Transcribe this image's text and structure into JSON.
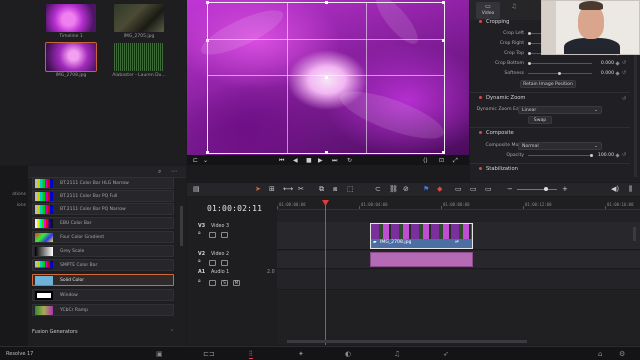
{
  "media_pool": {
    "clips": [
      {
        "name": "Timeline 1",
        "thumb": "flower"
      },
      {
        "name": "IMG_2705.jpg",
        "thumb": "dark"
      },
      {
        "name": "IMG_2708.jpg",
        "thumb": "flower2",
        "selected": true
      },
      {
        "name": "Alabaster - Lauren Du...",
        "thumb": "wave"
      }
    ]
  },
  "viewer": {
    "controls": [
      "⊏",
      "⌄",
      "⏮",
      "◀",
      "■",
      "▶",
      "⏭",
      "↻",
      "⟨⟩",
      "⊡",
      "⤢"
    ]
  },
  "inspector": {
    "tabs": [
      {
        "label": "Video",
        "icon": "video-icon",
        "active": true
      },
      {
        "label": "",
        "icon": "audio-icon",
        "active": false
      }
    ],
    "cropping": {
      "title": "Cropping",
      "params": [
        {
          "label": "Crop Left",
          "value": "",
          "knob": 0.0
        },
        {
          "label": "Crop Right",
          "value": "",
          "knob": 0.0
        },
        {
          "label": "Crop Top",
          "value": "0.000",
          "knob": 0.0
        },
        {
          "label": "Crop Bottom",
          "value": "0.000",
          "knob": 0.0
        },
        {
          "label": "Softness",
          "value": "0.000",
          "knob": 0.5
        }
      ],
      "retain_button": "Retain Image Position"
    },
    "dynamic_zoom": {
      "title": "Dynamic Zoom",
      "ease_label": "Dynamic Zoom Ease",
      "ease_value": "Linear",
      "swap_button": "Swap"
    },
    "composite": {
      "title": "Composite",
      "mode_label": "Composite Mode",
      "mode_value": "Normal",
      "opacity_label": "Opacity",
      "opacity_value": "100.00"
    },
    "stabilization": {
      "title": "Stabilization"
    }
  },
  "effects": {
    "side_labels": [
      "ations",
      "ions"
    ],
    "generators": [
      {
        "label": "BT.2111 Color Bar HLG Narrow",
        "swatch": "bars"
      },
      {
        "label": "BT.2111 Color Bar PQ Full",
        "swatch": "bars"
      },
      {
        "label": "BT.2111 Color Bar PQ Narrow",
        "swatch": "bars"
      },
      {
        "label": "EBU Color Bar",
        "swatch": "ebu"
      },
      {
        "label": "Four Color Gradient",
        "swatch": "four"
      },
      {
        "label": "Grey Scale",
        "swatch": "grey"
      },
      {
        "label": "SMPTE Color Bar",
        "swatch": "smpte"
      },
      {
        "label": "Solid Color",
        "swatch": "solid",
        "selected": true
      },
      {
        "label": "Window",
        "swatch": "window"
      },
      {
        "label": "YCbCr Ramp",
        "swatch": "ramp"
      }
    ],
    "fusion_header": "Fusion Generators"
  },
  "timeline": {
    "timecode": "01:00:02:11",
    "ruler_labels": [
      "01:00:00:00",
      "01:00:04:00",
      "01:00:08:00",
      "01:00:12:00",
      "01:00:16:00"
    ],
    "tracks": [
      {
        "id": "V3",
        "name": "Video 3"
      },
      {
        "id": "V2",
        "name": "Video 2"
      },
      {
        "id": "A1",
        "name": "Audio 1",
        "level": "2.0"
      }
    ],
    "video_clip_label": "IMG_2708.jpg"
  },
  "bottom_bar": {
    "app_name": "Resolve 17",
    "pages": [
      "media-icon",
      "cut-icon",
      "edit-icon",
      "fusion-icon",
      "color-icon",
      "fairlight-icon",
      "deliver-icon"
    ],
    "active_page": "edit-icon"
  },
  "colors": {
    "accent_orange": "#d46a3a",
    "playhead_red": "#e03a3a",
    "video_clip_blue": "#4d6ea3",
    "audio_clip_pink": "#b56ab5"
  }
}
